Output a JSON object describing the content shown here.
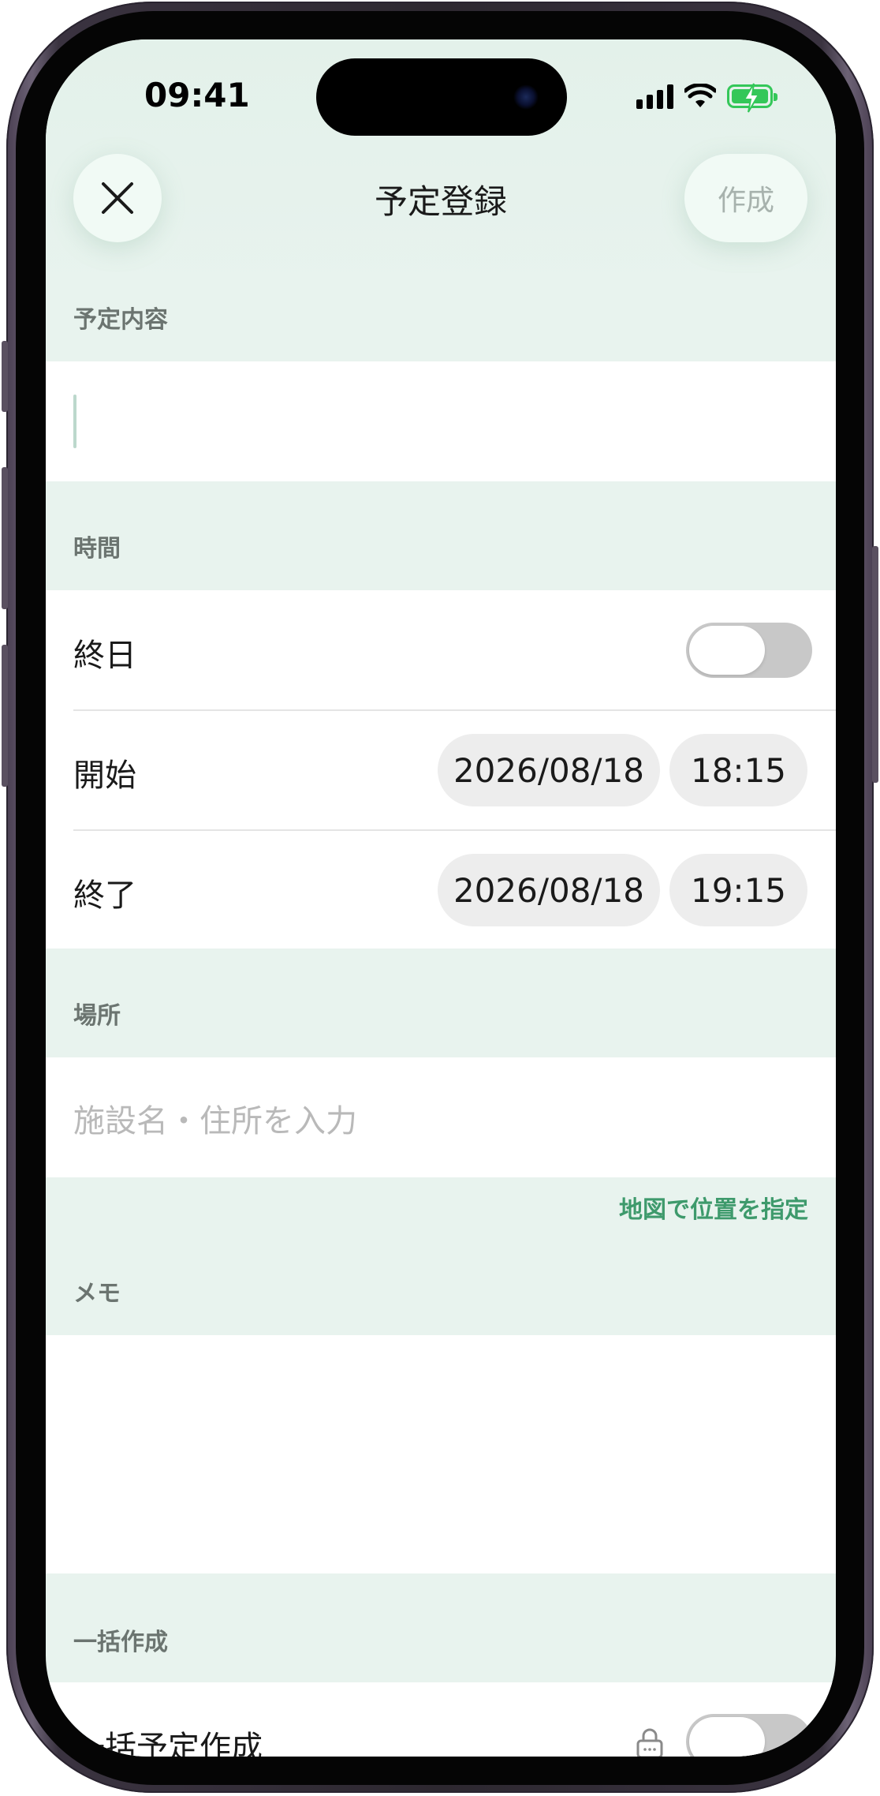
{
  "status_bar": {
    "time": "09:41"
  },
  "header": {
    "title": "予定登録",
    "create_label": "作成",
    "close_icon": "close-icon"
  },
  "sections": {
    "content": {
      "header": "予定内容",
      "input_value": ""
    },
    "time": {
      "header": "時間",
      "all_day_label": "終日",
      "all_day_on": false,
      "start_label": "開始",
      "start_date": "2026/08/18",
      "start_time": "18:15",
      "end_label": "終了",
      "end_date": "2026/08/18",
      "end_time": "19:15"
    },
    "location": {
      "header": "場所",
      "placeholder": "施設名・住所を入力",
      "map_link": "地図で位置を指定"
    },
    "memo": {
      "header": "メモ",
      "value": ""
    },
    "bulk": {
      "header": "一括作成",
      "label": "一括予定作成",
      "toggle_on": false,
      "lock_icon": "lock-icon"
    }
  },
  "colors": {
    "accent_green": "#3e9a6c",
    "section_bg": "#e8f3ee",
    "pill_bg": "#ededed",
    "toggle_off": "#c8c8c8"
  }
}
